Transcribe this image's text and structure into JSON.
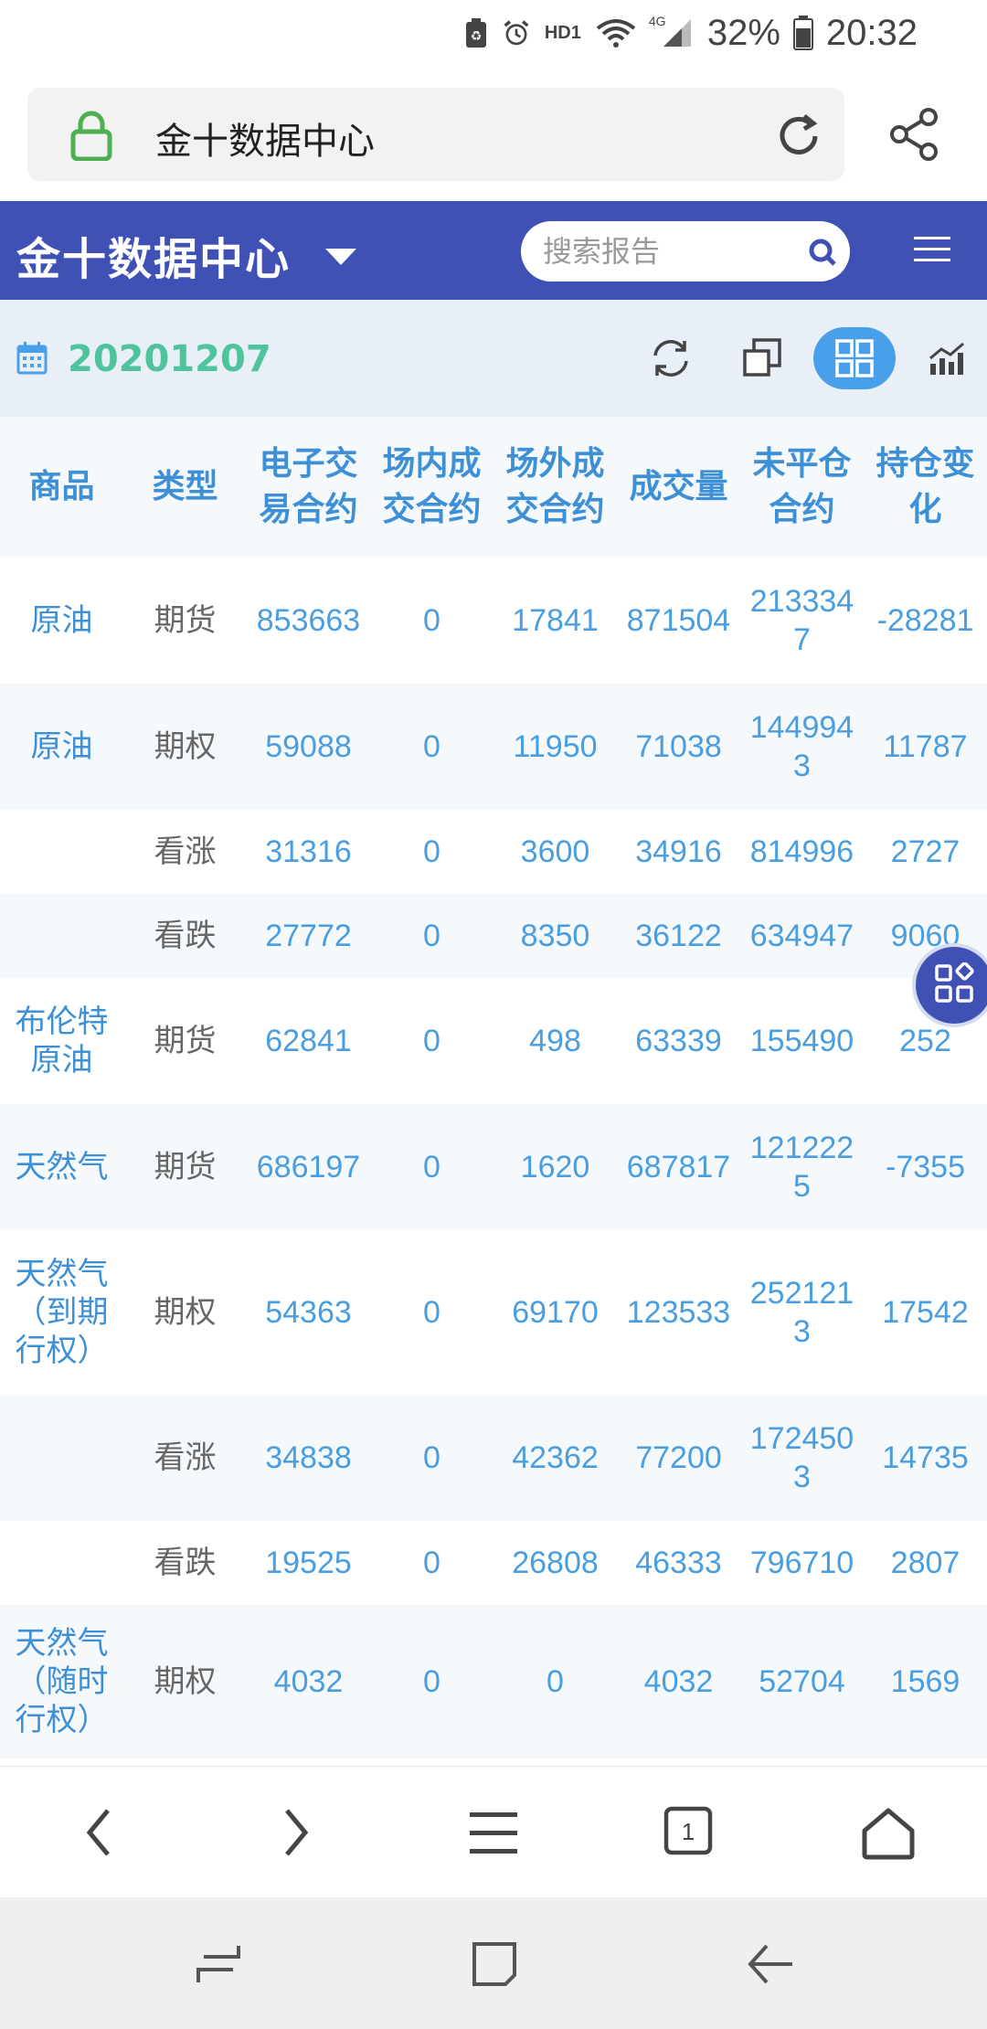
{
  "status_bar": {
    "network": "4G",
    "battery": "32%",
    "time": "20:32",
    "icons": [
      "battery-saver-icon",
      "alarm-icon",
      "hd-icon",
      "wifi-icon",
      "signal-icon",
      "battery-icon"
    ],
    "hd_label": "HD1"
  },
  "browser": {
    "url_title": "金十数据中心",
    "icons": {
      "lock": "lock-icon",
      "reload": "reload-icon",
      "share": "share-icon"
    },
    "accent": "#4caf50"
  },
  "header": {
    "title": "金十数据中心",
    "search_placeholder": "搜索报告",
    "color": "#3f51b5"
  },
  "toolbar": {
    "date": "20201207",
    "date_color": "#4fc39e",
    "active_color": "#4a9fea"
  },
  "table": {
    "columns": [
      "商品",
      "类型",
      "电子交易合约",
      "场内成交合约",
      "场外成交合约",
      "成交量",
      "未平仓合约",
      "持仓变化"
    ],
    "rows": [
      {
        "name": "原油",
        "type": "期货",
        "electronic": "853663",
        "pit": "0",
        "otc": "17841",
        "volume": "871504",
        "open_interest": "2133347",
        "change": "-28281"
      },
      {
        "name": "原油",
        "type": "期权",
        "electronic": "59088",
        "pit": "0",
        "otc": "11950",
        "volume": "71038",
        "open_interest": "1449943",
        "change": "11787"
      },
      {
        "name": "",
        "type": "看涨",
        "electronic": "31316",
        "pit": "0",
        "otc": "3600",
        "volume": "34916",
        "open_interest": "814996",
        "change": "2727"
      },
      {
        "name": "",
        "type": "看跌",
        "electronic": "27772",
        "pit": "0",
        "otc": "8350",
        "volume": "36122",
        "open_interest": "634947",
        "change": "9060"
      },
      {
        "name": "布伦特原油",
        "type": "期货",
        "electronic": "62841",
        "pit": "0",
        "otc": "498",
        "volume": "63339",
        "open_interest": "155490",
        "change": "252"
      },
      {
        "name": "天然气",
        "type": "期货",
        "electronic": "686197",
        "pit": "0",
        "otc": "1620",
        "volume": "687817",
        "open_interest": "1212225",
        "change": "-7355"
      },
      {
        "name": "天然气（到期行权）",
        "type": "期权",
        "electronic": "54363",
        "pit": "0",
        "otc": "69170",
        "volume": "123533",
        "open_interest": "2521213",
        "change": "17542"
      },
      {
        "name": "",
        "type": "看涨",
        "electronic": "34838",
        "pit": "0",
        "otc": "42362",
        "volume": "77200",
        "open_interest": "1724503",
        "change": "14735"
      },
      {
        "name": "",
        "type": "看跌",
        "electronic": "19525",
        "pit": "0",
        "otc": "26808",
        "volume": "46333",
        "open_interest": "796710",
        "change": "2807"
      },
      {
        "name": "天然气（随时行权）",
        "type": "期权",
        "electronic": "4032",
        "pit": "0",
        "otc": "0",
        "volume": "4032",
        "open_interest": "52704",
        "change": "1569"
      }
    ]
  },
  "browser_nav": {
    "tab_count": "1",
    "icons": [
      "back-icon",
      "forward-icon",
      "menu-icon",
      "tabs-icon",
      "home-icon"
    ]
  },
  "system_nav": {
    "icons": [
      "recent-apps-icon",
      "home-square-icon",
      "system-back-icon"
    ]
  }
}
